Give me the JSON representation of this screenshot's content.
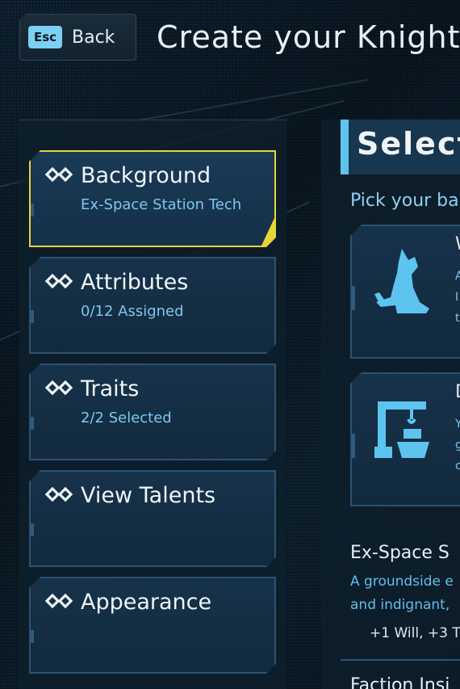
{
  "header": {
    "back_key": "Esc",
    "back_label": "Back",
    "title": "Create your Knight"
  },
  "sidebar": {
    "items": [
      {
        "title": "Background",
        "subtitle": "Ex-Space Station Tech",
        "active": true
      },
      {
        "title": "Attributes",
        "subtitle": "0/12 Assigned",
        "active": false
      },
      {
        "title": "Traits",
        "subtitle": "2/2 Selected",
        "active": false
      },
      {
        "title": "View Talents",
        "subtitle": "",
        "active": false
      },
      {
        "title": "Appearance",
        "subtitle": "",
        "active": false
      }
    ]
  },
  "main": {
    "heading": "Select",
    "instruction": "Pick your ba",
    "options": [
      {
        "icon": "wolf-icon",
        "title_peek": "W",
        "lines_peek": [
          "A",
          "I",
          "t"
        ]
      },
      {
        "icon": "crane-ship-icon",
        "title_peek": "D",
        "lines_peek": [
          "Y",
          "g",
          "c"
        ]
      }
    ],
    "detail": {
      "title": "Ex-Space S",
      "desc_line1": "A groundside e",
      "desc_line2": "and indignant,",
      "bonus": "+1 Will, +3 T"
    },
    "faction_title": "Faction Insi"
  },
  "colors": {
    "accent": "#5cc4ef",
    "active_border": "#e8d43a",
    "subtitle": "#7ec8ee"
  }
}
